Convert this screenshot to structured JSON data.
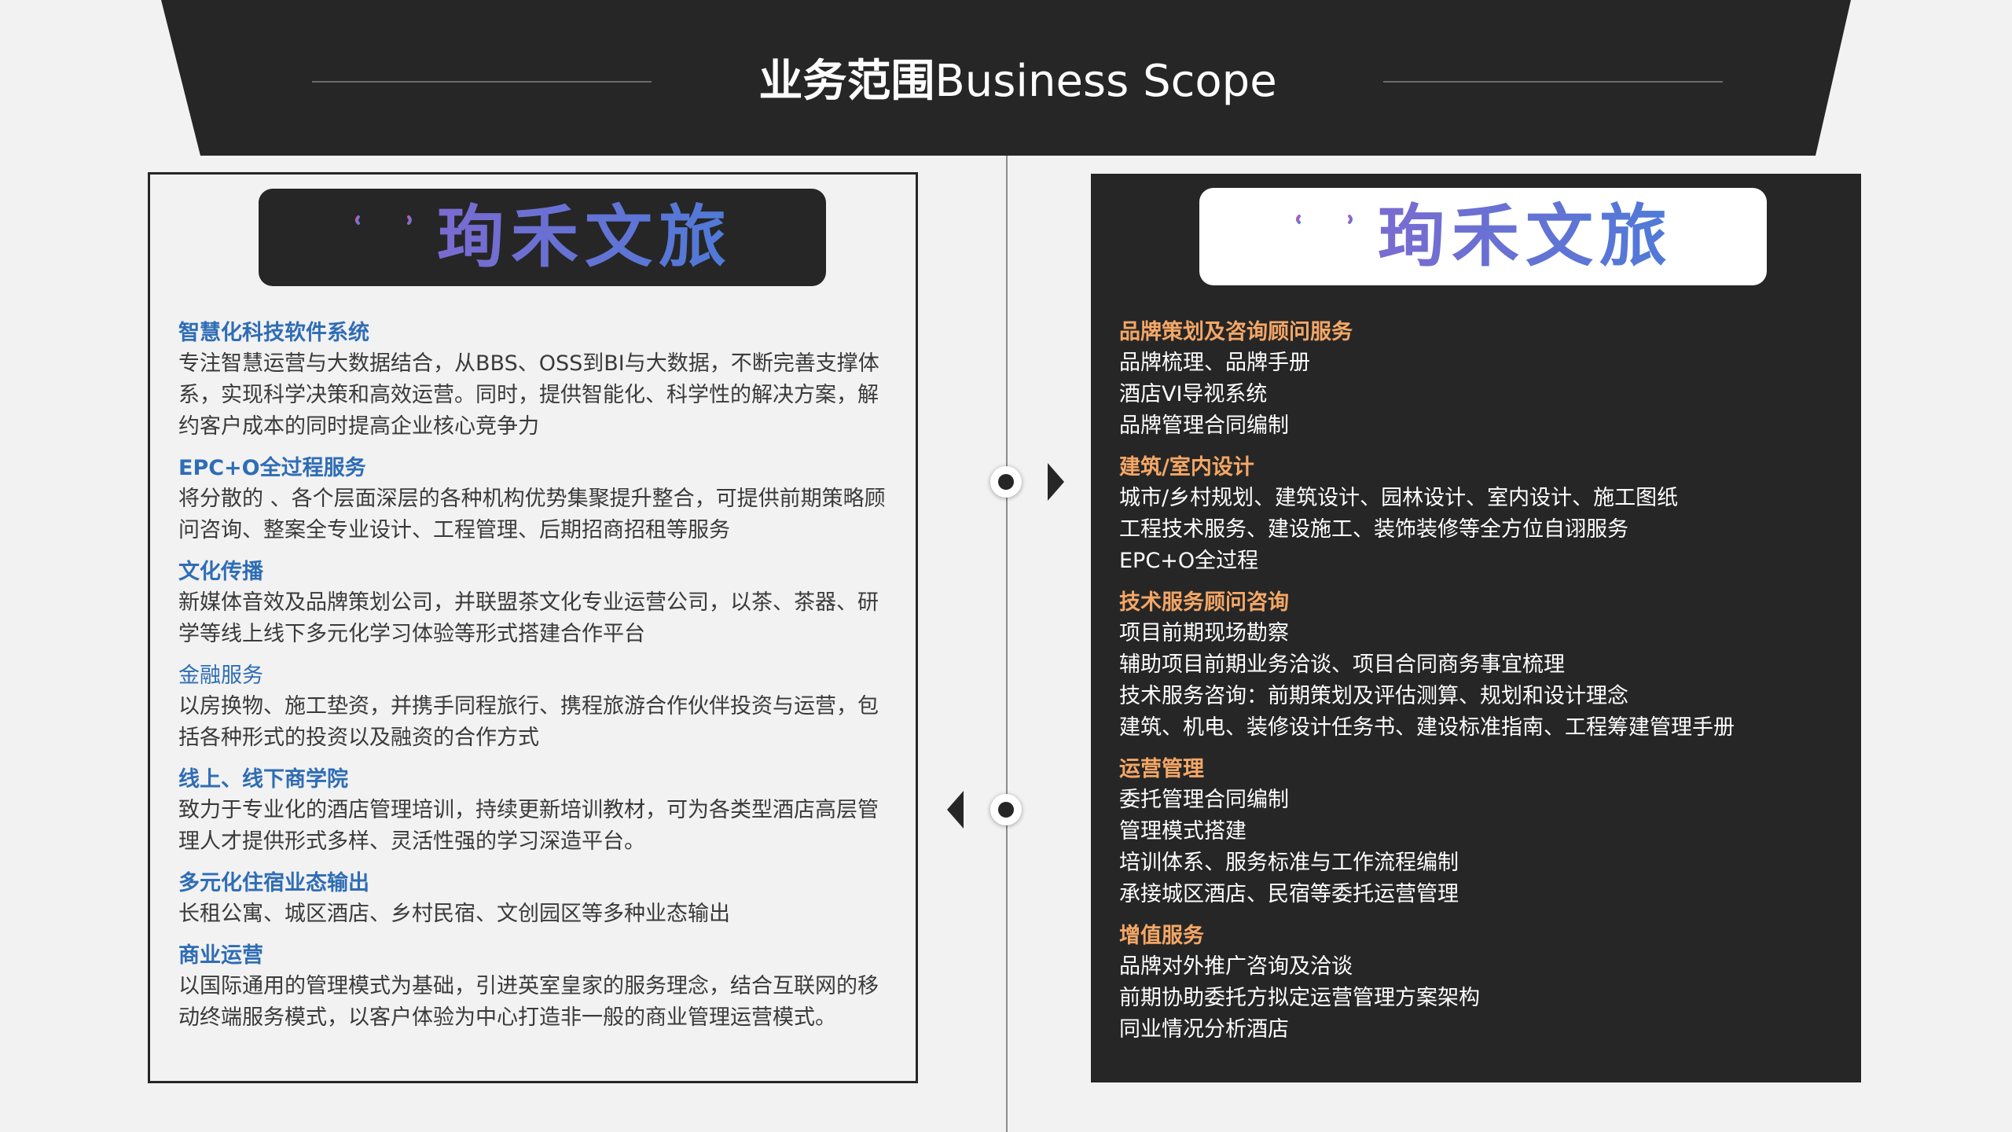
{
  "header": {
    "title_zh": "业务范围",
    "title_en": "Business Scope"
  },
  "left_panel": {
    "logo_text": "珣禾文旅",
    "sections": [
      {
        "title": "智慧化科技软件系统",
        "body": "专注智慧运营与大数据结合，从BBS、OSS到BI与大数据，不断完善支撑体系，实现科学决策和高效运营。同时，提供智能化、科学性的解决方案，解约客户成本的同时提高企业核心竞争力"
      },
      {
        "title": "EPC+O全过程服务",
        "body": "将分散的 、各个层面深层的各种机构优势集聚提升整合，可提供前期策略顾问咨询、整案全专业设计、工程管理、后期招商招租等服务"
      },
      {
        "title": "文化传播",
        "body": "新媒体音效及品牌策划公司，并联盟茶文化专业运营公司，以茶、茶器、研学等线上线下多元化学习体验等形式搭建合作平台"
      },
      {
        "title": "金融服务",
        "body": "以房换物、施工垫资，并携手同程旅行、携程旅游合作伙伴投资与运营，包括各种形式的投资以及融资的合作方式"
      },
      {
        "title": "线上、线下商学院",
        "body": "致力于专业化的酒店管理培训，持续更新培训教材，可为各类型酒店高层管理人才提供形式多样、灵活性强的学习深造平台。"
      },
      {
        "title": "多元化住宿业态输出",
        "body": "长租公寓、城区酒店、乡村民宿、文创园区等多种业态输出"
      },
      {
        "title": "商业运营",
        "body": "以国际通用的管理模式为基础，引进英室皇家的服务理念，结合互联网的移动终端服务模式，以客户体验为中心打造非一般的商业管理运营模式。"
      }
    ]
  },
  "right_panel": {
    "logo_text": "珣禾文旅",
    "sections": [
      {
        "title": "品牌策划及咨询顾问服务",
        "lines": [
          "品牌梳理、品牌手册",
          "酒店VI导视系统",
          "品牌管理合同编制"
        ]
      },
      {
        "title": "建筑/室内设计",
        "lines": [
          "城市/乡村规划、建筑设计、园林设计、室内设计、施工图纸",
          "工程技术服务、建设施工、装饰装修等全方位自诩服务",
          "EPC+O全过程"
        ]
      },
      {
        "title": "技术服务顾问咨询",
        "lines": [
          "项目前期现场勘察",
          "辅助项目前期业务洽谈、项目合同商务事宜梳理",
          "技术服务咨询：前期策划及评估测算、规划和设计理念",
          "建筑、机电、装修设计任务书、建设标准指南、工程筹建管理手册"
        ]
      },
      {
        "title": "运营管理",
        "lines": [
          "委托管理合同编制",
          "管理模式搭建",
          "培训体系、服务标准与工作流程编制",
          "承接城区酒店、民宿等委托运营管理"
        ]
      },
      {
        "title": "增值服务",
        "lines": [
          "品牌对外推广咨询及洽谈",
          "前期协助委托方拟定运营管理方案架构",
          "同业情况分析酒店"
        ]
      }
    ]
  },
  "colors": {
    "dark": "#262626",
    "left_heading": "#2f6db5",
    "right_heading": "#f4a766",
    "background": "#f2f2f2"
  }
}
